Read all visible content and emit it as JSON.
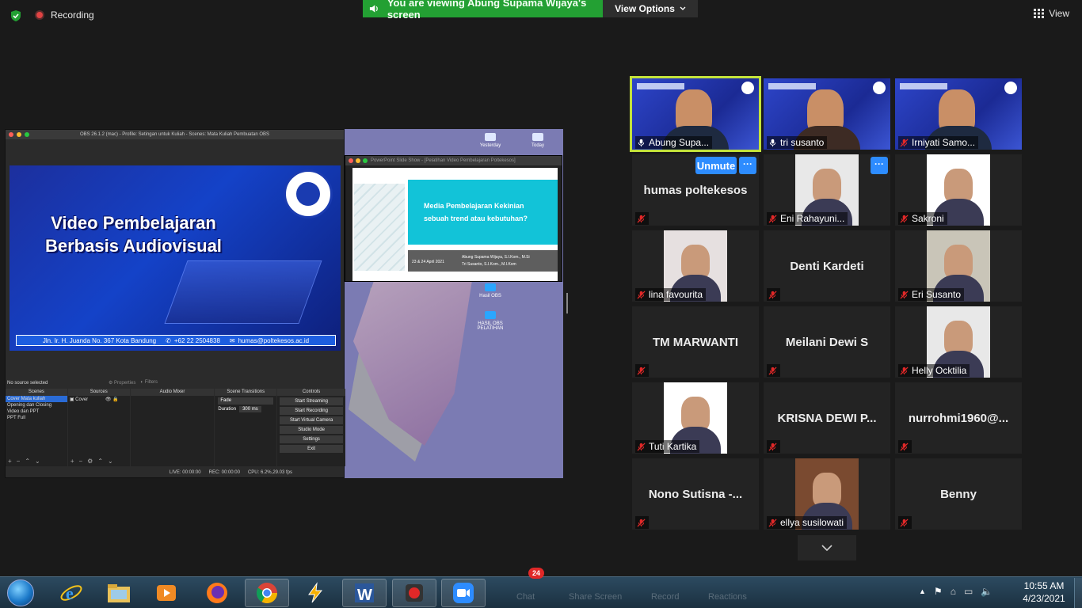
{
  "zoom": {
    "recording_label": "Recording",
    "viewing_banner": "You are viewing Abung Supama Wijaya's screen",
    "view_options": "View Options",
    "view": "View",
    "unmute": "Unmute",
    "more": "···"
  },
  "obs": {
    "title": "OBS 26.1.2 (mac) - Profile: Setingan untuk Kuliah - Scenes: Mata Kuliah Pembuatan OBS",
    "preview_title_line1": "Video Pembelajaran",
    "preview_title_line2": "Berbasis Audiovisual",
    "preview_address": "Jln. Ir. H. Juanda No. 367 Kota Bandung",
    "preview_phone": "+62 22 2504838",
    "preview_email": "humas@poltekesos.ac.id",
    "no_source": "No source selected",
    "properties": "Properties",
    "filters": "Filters",
    "docks": {
      "scenes": "Scenes",
      "sources": "Sources",
      "audio_mixer": "Audio Mixer",
      "scene_transitions": "Scene Transitions",
      "controls": "Controls"
    },
    "scenes": [
      "Cover Mata kuliah",
      "Opening dan Closing",
      "Video dan PPT",
      "PPT Full"
    ],
    "sources": [
      "Cover"
    ],
    "transition": "Fade",
    "duration_label": "Duration",
    "duration_value": "300 ms",
    "controls": [
      "Start Streaming",
      "Start Recording",
      "Start Virtual Camera",
      "Studio Mode",
      "Settings",
      "Exit"
    ],
    "status_live": "LIVE: 00:00:00",
    "status_rec": "REC: 00:00:00",
    "status_cpu": "CPU: 6.2%,29.03 fps"
  },
  "desktop": {
    "icons": [
      "Yesterday",
      "Today",
      "Hasil OBS",
      "HASIL OBS PELATIHAN"
    ]
  },
  "ppt": {
    "title": "PowerPoint Slide Show - [Pelatihan Video Pembelajaran Poltekesos]",
    "heading_line1": "Media Pembelajaran Kekinian",
    "heading_line2": "sebuah trend atau kebutuhan?",
    "date": "23 & 24 April 2021",
    "author1": "Abung Supama Wijaya, S.I.Kom., M.Si",
    "author2": "Tri Susanto, S.I.Kom., M.I.Kom"
  },
  "participants": [
    {
      "name": "Abung Supa...",
      "type": "video"
    },
    {
      "name": "tri susanto",
      "type": "video"
    },
    {
      "name": "Irniyati Samo...",
      "type": "video"
    },
    {
      "name": "humas poltekesos",
      "type": "name"
    },
    {
      "name": "Eni Rahayuni...",
      "type": "photo"
    },
    {
      "name": "Sakroni",
      "type": "photo"
    },
    {
      "name": "lina favourita",
      "type": "photo"
    },
    {
      "name": "Denti Kardeti",
      "type": "name"
    },
    {
      "name": "Eri Susanto",
      "type": "photo"
    },
    {
      "name": "TM MARWANTI",
      "type": "name"
    },
    {
      "name": "Meilani Dewi S",
      "type": "name"
    },
    {
      "name": "Helly Ocktilia",
      "type": "photo"
    },
    {
      "name": "Tuti Kartika",
      "type": "photo"
    },
    {
      "name": "KRISNA DEWI P...",
      "type": "name"
    },
    {
      "name": "nurrohmi1960@...",
      "type": "name"
    },
    {
      "name": "Nono Sutisna -...",
      "type": "name"
    },
    {
      "name": "ellya susilowati",
      "type": "photo"
    },
    {
      "name": "Benny",
      "type": "name"
    }
  ],
  "taskbar": {
    "chat_badge": "24",
    "ghost_labels": [
      "Chat",
      "Share Screen",
      "Record",
      "Reactions"
    ],
    "time": "10:55 AM",
    "date": "4/23/2021"
  },
  "colors": {
    "zoom_bg": "#1a1a1a",
    "banner_green": "#23a033",
    "zoom_blue": "#2d8cff",
    "active_speaker": "#c4e33a",
    "muted_red": "#e02828"
  }
}
